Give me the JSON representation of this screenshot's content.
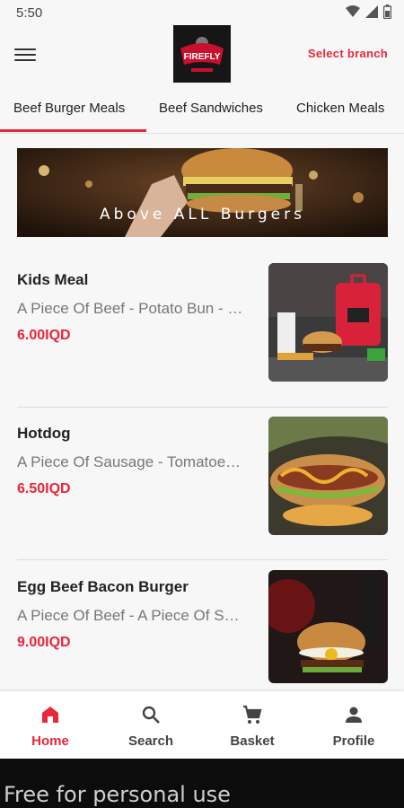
{
  "status": {
    "time": "5:50",
    "icons": [
      "wifi-icon",
      "signal-icon",
      "battery-icon"
    ]
  },
  "header": {
    "menu_icon": "hamburger-menu-icon",
    "logo_text": "FIREFLY",
    "select_branch": "Select branch"
  },
  "tabs": [
    {
      "label": "Beef Burger Meals",
      "active": true
    },
    {
      "label": "Beef Sandwiches",
      "active": false
    },
    {
      "label": "Chicken Meals",
      "active": false
    }
  ],
  "banner": {
    "text": "Above ALL Burgers"
  },
  "items": [
    {
      "name": "Kids Meal",
      "description": "A Piece Of Beef - Potato Bun - …",
      "price": "6.00IQD"
    },
    {
      "name": "Hotdog",
      "description": "A Piece Of Sausage - Tomatoe…",
      "price": "6.50IQD"
    },
    {
      "name": "Egg Beef Bacon Burger",
      "description": "A Piece Of Beef - A Piece Of S…",
      "price": "9.00IQD"
    }
  ],
  "bottom_nav": [
    {
      "label": "Home",
      "icon": "home-icon",
      "active": true
    },
    {
      "label": "Search",
      "icon": "search-icon",
      "active": false
    },
    {
      "label": "Basket",
      "icon": "cart-icon",
      "active": false
    },
    {
      "label": "Profile",
      "icon": "person-icon",
      "active": false
    }
  ],
  "watermark": "Free for personal use",
  "colors": {
    "accent": "#e8273a",
    "background": "#f7f7f7"
  }
}
